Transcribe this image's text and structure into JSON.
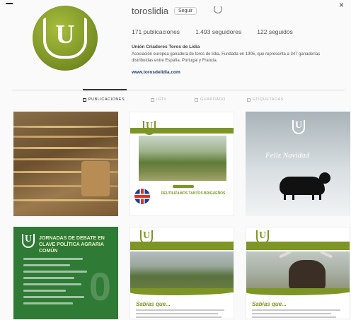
{
  "profile": {
    "username": "toroslidia",
    "follow_label": "Seguir",
    "options_icon": "gear-icon",
    "avatar_letter": "U",
    "stats": {
      "posts": "171 publicaciones",
      "followers": "1.493 seguidores",
      "following": "122 seguidos"
    },
    "bio_name": "Unión Criadores Toros de Lidia",
    "bio_text": "Asociación europea ganadera de toros de lidia. Fundada en 1905, que representa a 347 ganaderías distribuidas entre España, Portugal y Francia.",
    "bio_link": "www.torosdelidia.com"
  },
  "tabs": [
    {
      "label": "PUBLICACIONES",
      "icon": "grid-icon",
      "active": true
    },
    {
      "label": "IGTV",
      "icon": "tv-icon",
      "active": false
    },
    {
      "label": "GUARDADO",
      "icon": "bookmark-icon",
      "active": false
    },
    {
      "label": "ETIQUETADAS",
      "icon": "tag-icon",
      "active": false
    }
  ],
  "posts": {
    "p2_caption": "REUTILIZAMOS TANTOS BRIGUEÑOS",
    "p3_greeting": "Feliz Navidad",
    "p4_title": "JORNADAS DE DEBATE EN CLAVE POLÍTICA AGRARIA COMÚN",
    "p5_heading": "Sabías que...",
    "p6_heading": "Sabías que..."
  },
  "colors": {
    "brand_green": "#7d9526",
    "dark_green": "#2f7a35"
  }
}
